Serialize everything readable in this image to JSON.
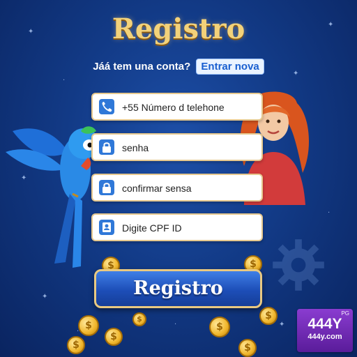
{
  "header": {
    "title": "Registro",
    "prompt": "Jáá tem una conta?",
    "login_link": "Entrar nova"
  },
  "form": {
    "phone": {
      "placeholder": "+55 Número d telehone",
      "icon": "phone-icon"
    },
    "password": {
      "placeholder": "senha",
      "icon": "lock-icon"
    },
    "confirm_password": {
      "placeholder": "confirmar sensa",
      "icon": "lock-icon"
    },
    "cpf": {
      "placeholder": "Digite CPF ID",
      "icon": "id-card-icon"
    }
  },
  "submit": {
    "label": "Registro"
  },
  "brand": {
    "provider": "PG",
    "logo_text": "444Y",
    "domain": "444y.com"
  },
  "colors": {
    "background": "#123a86",
    "title_gold": "#f3d27a",
    "button_blue": "#1d4eb8",
    "field_border": "#e6c88e",
    "icon_blue": "#2f78d8",
    "badge_purple": "#6e28b0"
  }
}
